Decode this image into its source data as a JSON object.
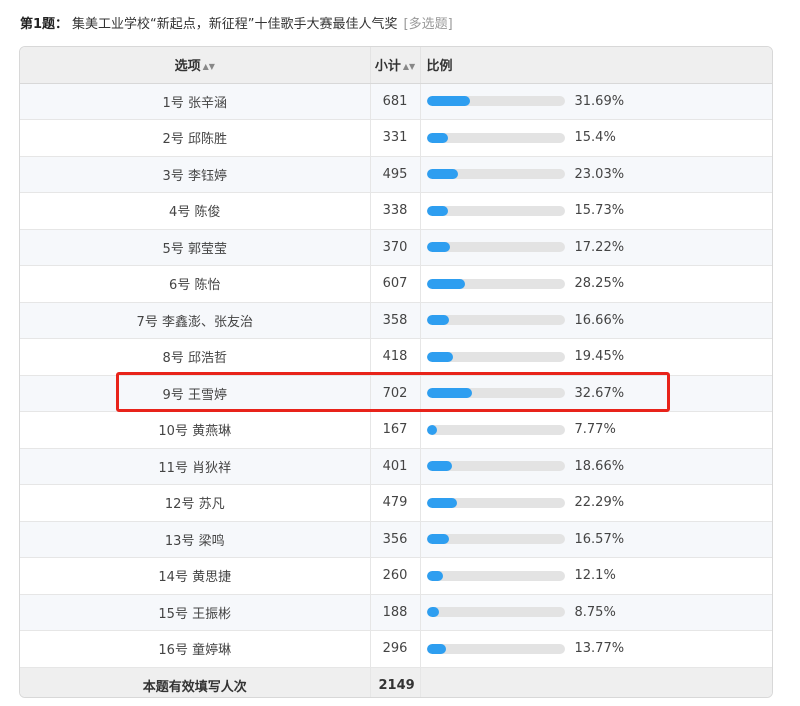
{
  "question": {
    "number": "第1题：",
    "text": "集美工业学校“新起点，新征程”十佳歌手大赛最佳人气奖",
    "type": "[多选题]"
  },
  "table": {
    "headers": {
      "option": "选项",
      "count": "小计",
      "ratio": "比例"
    },
    "rows": [
      {
        "option": "1号 张辛涵",
        "count": "681",
        "percent": "31.69%",
        "fill": 31.69
      },
      {
        "option": "2号 邱陈胜",
        "count": "331",
        "percent": "15.4%",
        "fill": 15.4
      },
      {
        "option": "3号 李钰婷",
        "count": "495",
        "percent": "23.03%",
        "fill": 23.03
      },
      {
        "option": "4号 陈俊",
        "count": "338",
        "percent": "15.73%",
        "fill": 15.73
      },
      {
        "option": "5号 郭莹莹",
        "count": "370",
        "percent": "17.22%",
        "fill": 17.22
      },
      {
        "option": "6号 陈怡",
        "count": "607",
        "percent": "28.25%",
        "fill": 28.25
      },
      {
        "option": "7号 李鑫澎、张友治",
        "count": "358",
        "percent": "16.66%",
        "fill": 16.66
      },
      {
        "option": "8号 邱浩哲",
        "count": "418",
        "percent": "19.45%",
        "fill": 19.45
      },
      {
        "option": "9号 王雪婷",
        "count": "702",
        "percent": "32.67%",
        "fill": 32.67
      },
      {
        "option": "10号 黄燕琳",
        "count": "167",
        "percent": "7.77%",
        "fill": 7.77
      },
      {
        "option": "11号 肖狄祥",
        "count": "401",
        "percent": "18.66%",
        "fill": 18.66
      },
      {
        "option": "12号 苏凡",
        "count": "479",
        "percent": "22.29%",
        "fill": 22.29
      },
      {
        "option": "13号 梁鸣",
        "count": "356",
        "percent": "16.57%",
        "fill": 16.57
      },
      {
        "option": "14号 黄思捷",
        "count": "260",
        "percent": "12.1%",
        "fill": 12.1
      },
      {
        "option": "15号 王振彬",
        "count": "188",
        "percent": "8.75%",
        "fill": 8.75
      },
      {
        "option": "16号 童婷琳",
        "count": "296",
        "percent": "13.77%",
        "fill": 13.77
      }
    ],
    "total": {
      "label": "本题有效填写人次",
      "count": "2149"
    }
  },
  "colors": {
    "bar": "#2e9ef0",
    "track": "#e3e3e3",
    "highlight": "#e8231a"
  },
  "icons": {
    "sort": "sort-icon"
  }
}
